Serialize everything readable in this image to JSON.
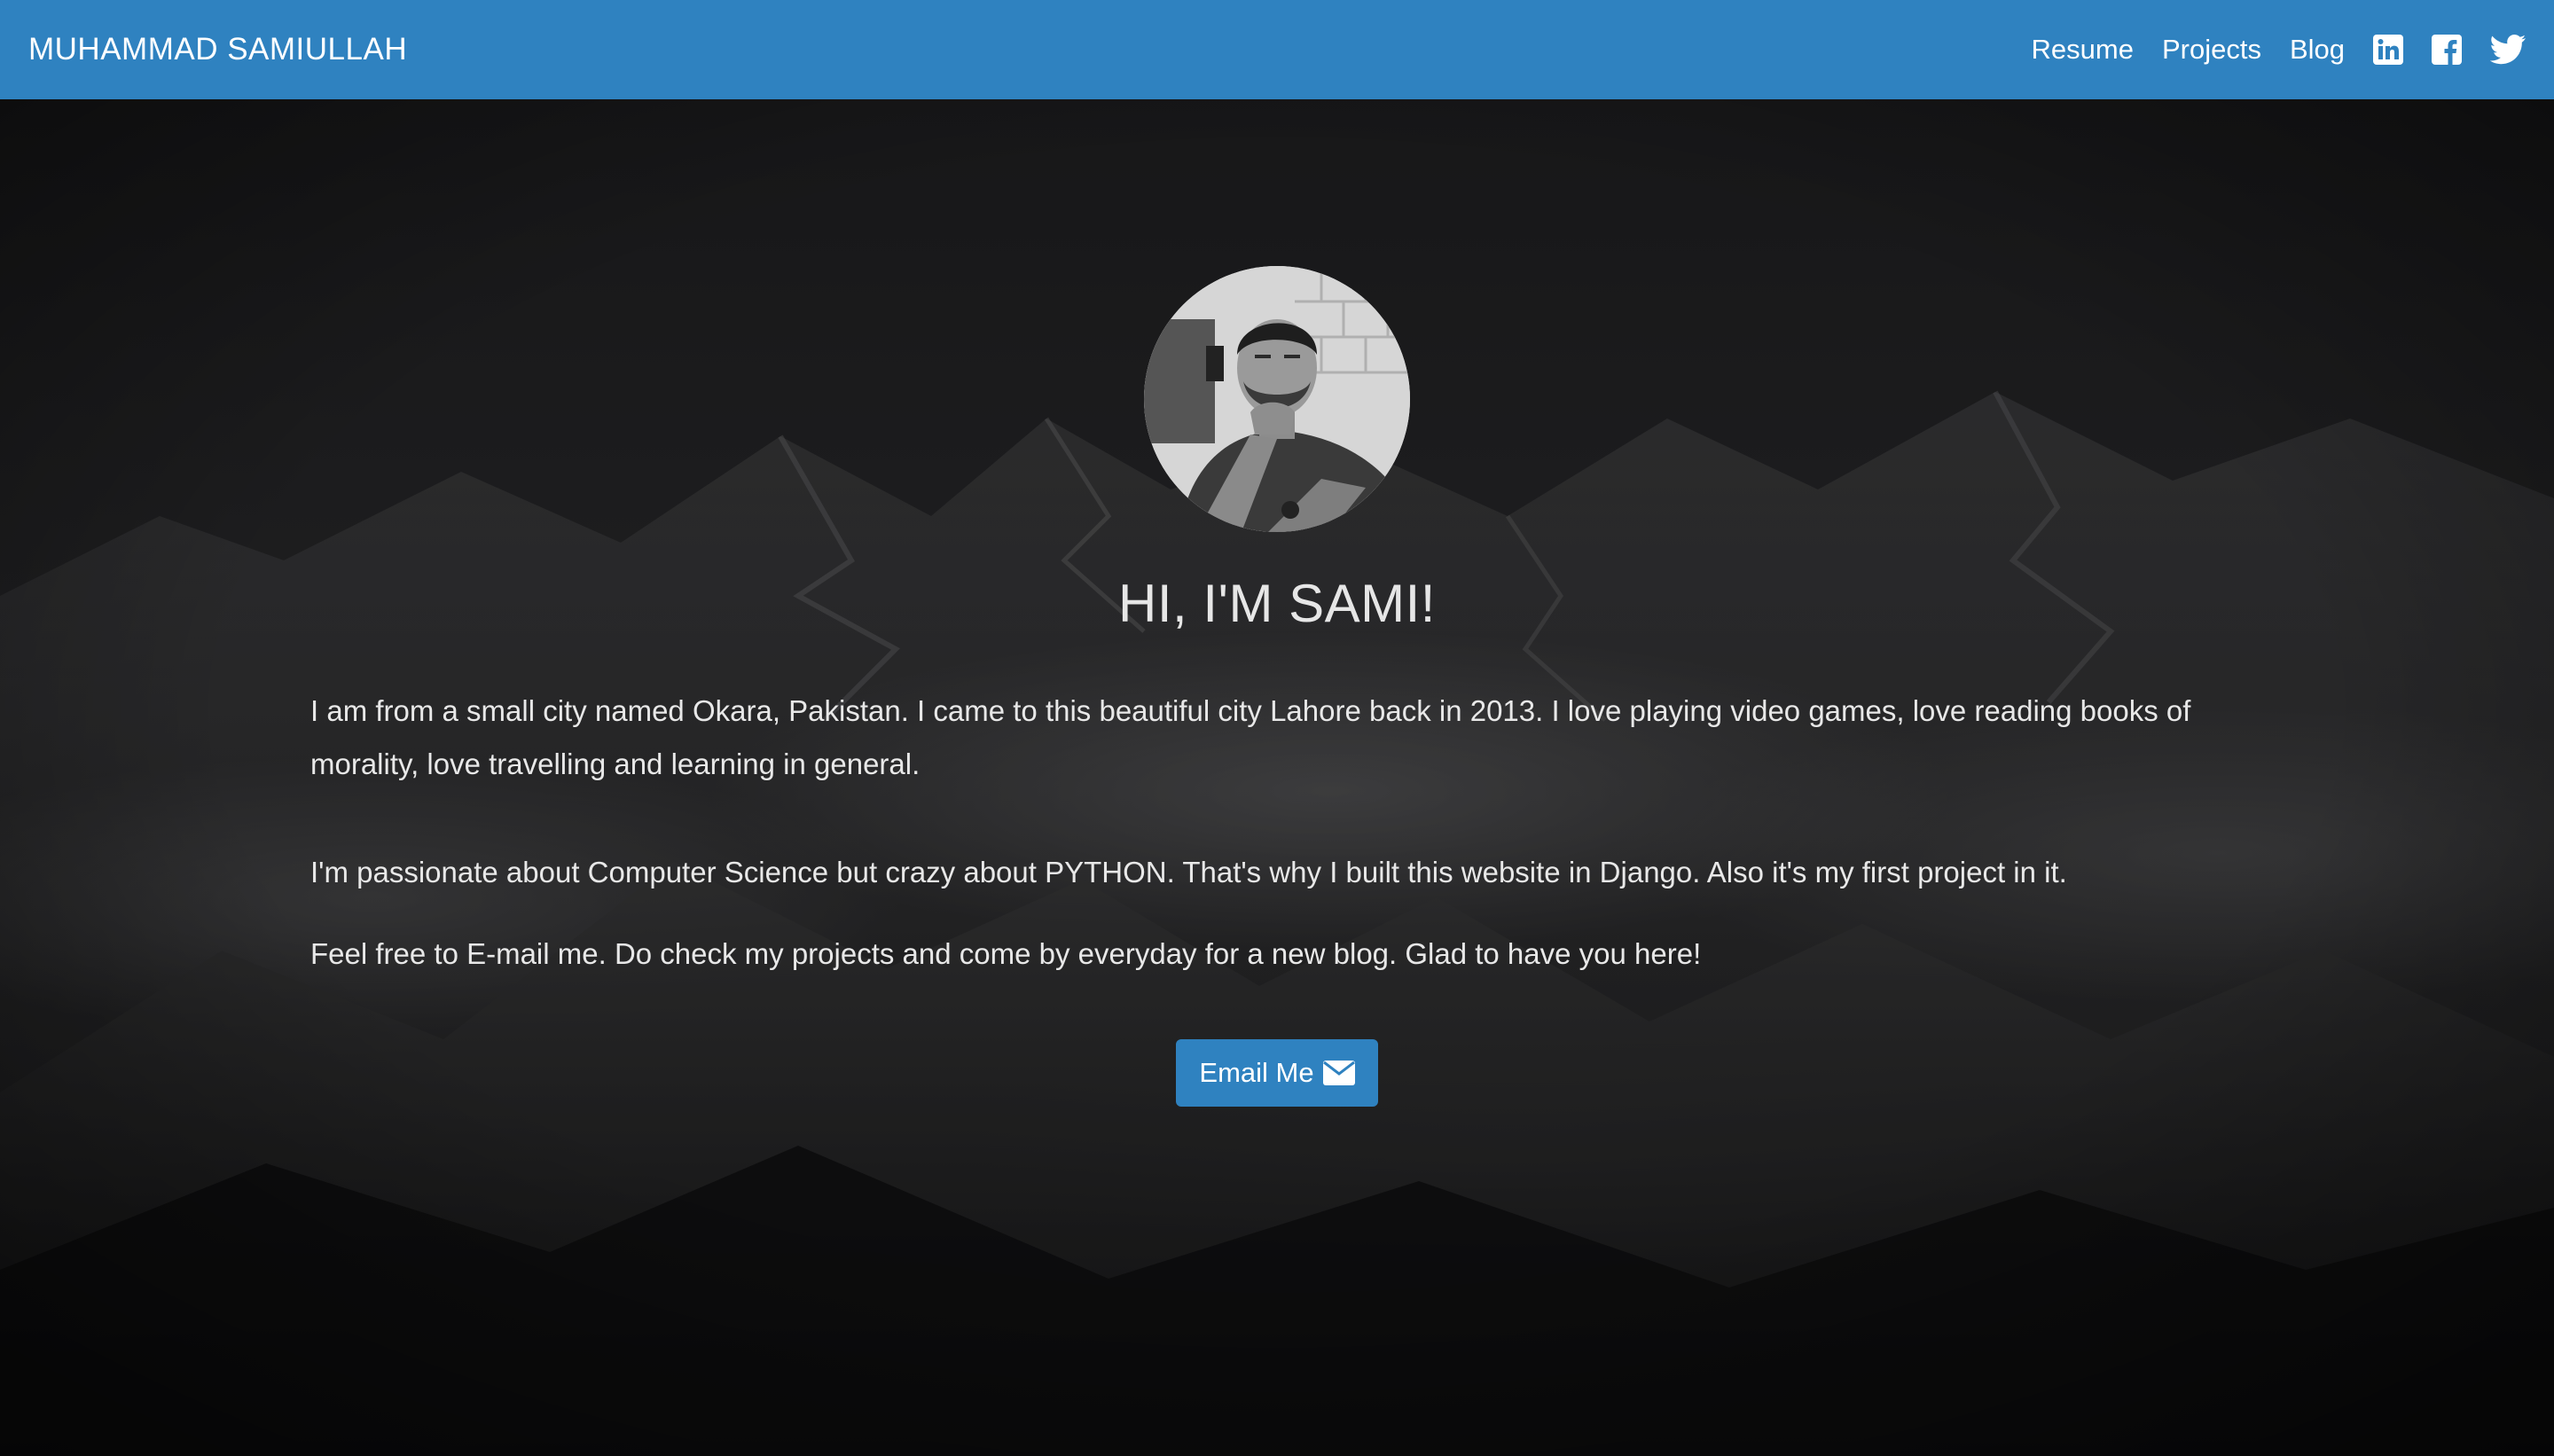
{
  "navbar": {
    "brand": "MUHAMMAD SAMIULLAH",
    "links": [
      "Resume",
      "Projects",
      "Blog"
    ],
    "icons": [
      "linkedin-icon",
      "facebook-icon",
      "twitter-icon"
    ],
    "color": "#2f82c0"
  },
  "hero": {
    "heading": "HI, I'M SAMI!",
    "paragraphs": [
      "I am from a small city named Okara, Pakistan. I came to this beautiful city Lahore back in 2013. I love playing video games, love reading books of morality, love travelling and learning in general.",
      "I'm passionate about Computer Science but crazy about PYTHON. That's why I built this website in Django. Also it's my first project in it.",
      "Feel free to E-mail me. Do check my projects and come by everyday for a new blog. Glad to have you here!"
    ],
    "button_label": "Email Me",
    "button_icon": "envelope-icon"
  }
}
